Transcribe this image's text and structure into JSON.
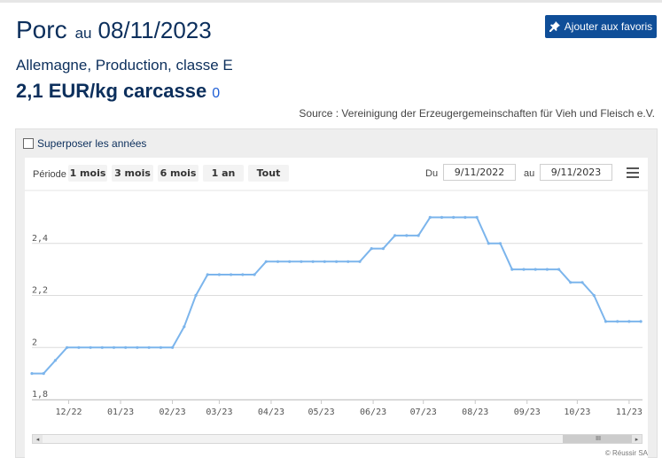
{
  "header": {
    "title": "Porc",
    "au": "au",
    "date": "08/11/2023",
    "favorite_label": "Ajouter aux favoris",
    "favorite_icon": "pin-icon",
    "subtitle": "Allemagne, Production, classe E",
    "price": "2,1 EUR/kg carcasse",
    "price_change": "0",
    "source": "Source : Vereinigung der Erzeugergemeinschaften für Vieh und Fleisch e.V."
  },
  "panel": {
    "overlay_label": "Superposer les années",
    "overlay_checked": false
  },
  "toolbar": {
    "periode_label": "Période",
    "range_buttons": [
      "1 mois",
      "3 mois",
      "6 mois",
      "1 an",
      "Tout"
    ],
    "du_label": "Du",
    "du_value": "9/11/2022",
    "au_label": "au",
    "au_value": "9/11/2023",
    "menu_icon": "hamburger-menu-icon"
  },
  "credit": "© Réussir SA",
  "colors": {
    "brand": "#0c2f5c",
    "button": "#0f4e98",
    "line": "#7cb5ec",
    "change": "#1f5fd6"
  },
  "chart_data": {
    "type": "line",
    "title": "",
    "xlabel": "",
    "ylabel": "",
    "ylim": [
      1.8,
      2.6
    ],
    "yticks": [
      1.8,
      2.0,
      2.2,
      2.4
    ],
    "ytick_labels": [
      "1,8",
      "2",
      "2,2",
      "2,4"
    ],
    "xticks": [
      "2022-12-01",
      "2023-01-01",
      "2023-02-01",
      "2023-03-01",
      "2023-04-01",
      "2023-05-01",
      "2023-06-01",
      "2023-07-01",
      "2023-08-01",
      "2023-09-01",
      "2023-10-01",
      "2023-11-01"
    ],
    "xtick_labels": [
      "12/22",
      "01/23",
      "02/23",
      "03/23",
      "04/23",
      "05/23",
      "06/23",
      "07/23",
      "08/23",
      "09/23",
      "10/23",
      "11/23"
    ],
    "xlim": [
      "2022-11-09",
      "2023-11-09"
    ],
    "grid": true,
    "legend": false,
    "series": [
      {
        "x": [
          "2022-11-09",
          "2022-11-16",
          "2022-11-23",
          "2022-11-30",
          "2022-12-07",
          "2022-12-14",
          "2022-12-21",
          "2022-12-28",
          "2023-01-04",
          "2023-01-11",
          "2023-01-18",
          "2023-01-25",
          "2023-02-01",
          "2023-02-08",
          "2023-02-15",
          "2023-02-22",
          "2023-03-01",
          "2023-03-08",
          "2023-03-15",
          "2023-03-22",
          "2023-03-29",
          "2023-04-05",
          "2023-04-12",
          "2023-04-19",
          "2023-04-26",
          "2023-05-03",
          "2023-05-10",
          "2023-05-17",
          "2023-05-24",
          "2023-05-31",
          "2023-06-07",
          "2023-06-14",
          "2023-06-21",
          "2023-06-28",
          "2023-07-05",
          "2023-07-12",
          "2023-07-19",
          "2023-07-26",
          "2023-08-02",
          "2023-08-09",
          "2023-08-16",
          "2023-08-23",
          "2023-08-30",
          "2023-09-06",
          "2023-09-13",
          "2023-09-20",
          "2023-09-27",
          "2023-10-04",
          "2023-10-11",
          "2023-10-18",
          "2023-10-25",
          "2023-11-01",
          "2023-11-08"
        ],
        "y": [
          1.9,
          1.9,
          1.95,
          2.0,
          2.0,
          2.0,
          2.0,
          2.0,
          2.0,
          2.0,
          2.0,
          2.0,
          2.0,
          2.08,
          2.2,
          2.28,
          2.28,
          2.28,
          2.28,
          2.28,
          2.33,
          2.33,
          2.33,
          2.33,
          2.33,
          2.33,
          2.33,
          2.33,
          2.33,
          2.38,
          2.38,
          2.43,
          2.43,
          2.43,
          2.5,
          2.5,
          2.5,
          2.5,
          2.5,
          2.4,
          2.4,
          2.3,
          2.3,
          2.3,
          2.3,
          2.3,
          2.25,
          2.25,
          2.2,
          2.1,
          2.1,
          2.1,
          2.1
        ]
      }
    ]
  }
}
